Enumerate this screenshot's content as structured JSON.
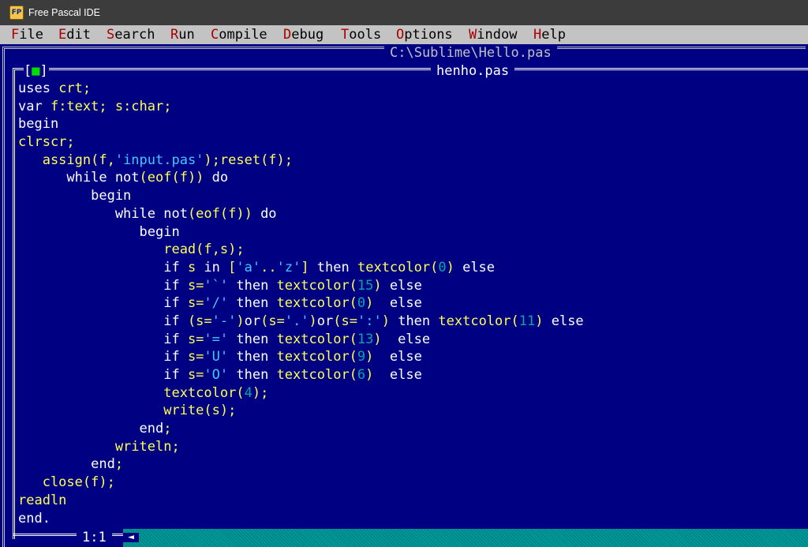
{
  "window": {
    "app_title": "Free Pascal IDE",
    "app_icon": "free-pascal-icon"
  },
  "menu": {
    "items": [
      {
        "hot": "F",
        "rest": "ile"
      },
      {
        "hot": "E",
        "rest": "dit"
      },
      {
        "hot": "S",
        "rest": "earch"
      },
      {
        "hot": "R",
        "rest": "un"
      },
      {
        "hot": "C",
        "rest": "ompile"
      },
      {
        "hot": "D",
        "rest": "ebug"
      },
      {
        "hot": "T",
        "rest": "ools"
      },
      {
        "hot": "O",
        "rest": "ptions"
      },
      {
        "hot": "W",
        "rest": "indow"
      },
      {
        "hot": "H",
        "rest": "elp"
      }
    ]
  },
  "outer_window": {
    "title": "C:\\Sublime\\Hello.pas"
  },
  "inner_window": {
    "title": "henho.pas",
    "close_box": {
      "left": "[",
      "square": "■",
      "right": "]"
    }
  },
  "editor": {
    "lines": [
      [
        [
          "w",
          "uses "
        ],
        [
          "y",
          "crt;"
        ]
      ],
      [
        [
          "w",
          "var "
        ],
        [
          "y",
          "f:text; s:char;"
        ]
      ],
      [
        [
          "w",
          "begin"
        ]
      ],
      [
        [
          "y",
          "clrscr;"
        ]
      ],
      [
        [
          "y",
          "   assign(f,"
        ],
        [
          "c",
          "'input.pas'"
        ],
        [
          "y",
          ");reset(f);"
        ]
      ],
      [
        [
          "w",
          "      while not"
        ],
        [
          "y",
          "(eof(f))"
        ],
        [
          "w",
          " do"
        ]
      ],
      [
        [
          "w",
          "         begin"
        ]
      ],
      [
        [
          "w",
          "            while not"
        ],
        [
          "y",
          "(eof(f))"
        ],
        [
          "w",
          " do"
        ]
      ],
      [
        [
          "w",
          "               begin"
        ]
      ],
      [
        [
          "y",
          "                  read(f,s);"
        ]
      ],
      [
        [
          "w",
          "                  if "
        ],
        [
          "y",
          "s "
        ],
        [
          "w",
          "in "
        ],
        [
          "y",
          "["
        ],
        [
          "c",
          "'a'"
        ],
        [
          "y",
          ".."
        ],
        [
          "c",
          "'z'"
        ],
        [
          "y",
          "] "
        ],
        [
          "w",
          "then "
        ],
        [
          "y",
          "textcolor("
        ],
        [
          "n",
          "0"
        ],
        [
          "y",
          ")"
        ],
        [
          "w",
          " else"
        ]
      ],
      [
        [
          "w",
          "                  if "
        ],
        [
          "y",
          "s="
        ],
        [
          "c",
          "'`'"
        ],
        [
          "w",
          " then "
        ],
        [
          "y",
          "textcolor("
        ],
        [
          "n",
          "15"
        ],
        [
          "y",
          ")"
        ],
        [
          "w",
          " else"
        ]
      ],
      [
        [
          "w",
          "                  if "
        ],
        [
          "y",
          "s="
        ],
        [
          "c",
          "'/'"
        ],
        [
          "w",
          " then "
        ],
        [
          "y",
          "textcolor("
        ],
        [
          "n",
          "0"
        ],
        [
          "y",
          ")"
        ],
        [
          "w",
          "  else"
        ]
      ],
      [
        [
          "w",
          "                  if "
        ],
        [
          "y",
          "(s="
        ],
        [
          "c",
          "'-'"
        ],
        [
          "y",
          ")"
        ],
        [
          "w",
          "or"
        ],
        [
          "y",
          "(s="
        ],
        [
          "c",
          "'.'"
        ],
        [
          "y",
          ")"
        ],
        [
          "w",
          "or"
        ],
        [
          "y",
          "(s="
        ],
        [
          "c",
          "':'"
        ],
        [
          "y",
          ")"
        ],
        [
          "w",
          " then "
        ],
        [
          "y",
          "textcolor("
        ],
        [
          "n",
          "11"
        ],
        [
          "y",
          ")"
        ],
        [
          "w",
          " else"
        ]
      ],
      [
        [
          "w",
          "                  if "
        ],
        [
          "y",
          "s="
        ],
        [
          "c",
          "'='"
        ],
        [
          "w",
          " then "
        ],
        [
          "y",
          "textcolor("
        ],
        [
          "n",
          "13"
        ],
        [
          "y",
          ")"
        ],
        [
          "w",
          "  else"
        ]
      ],
      [
        [
          "w",
          "                  if "
        ],
        [
          "y",
          "s="
        ],
        [
          "c",
          "'U'"
        ],
        [
          "w",
          " then "
        ],
        [
          "y",
          "textcolor("
        ],
        [
          "n",
          "9"
        ],
        [
          "y",
          ")"
        ],
        [
          "w",
          "  else"
        ]
      ],
      [
        [
          "w",
          "                  if "
        ],
        [
          "y",
          "s="
        ],
        [
          "c",
          "'O'"
        ],
        [
          "w",
          " then "
        ],
        [
          "y",
          "textcolor("
        ],
        [
          "n",
          "6"
        ],
        [
          "y",
          ")"
        ],
        [
          "w",
          "  else"
        ]
      ],
      [
        [
          "y",
          "                  textcolor("
        ],
        [
          "n",
          "4"
        ],
        [
          "y",
          ");"
        ]
      ],
      [
        [
          "y",
          "                  write(s);"
        ]
      ],
      [
        [
          "w",
          "               end"
        ],
        [
          "y",
          ";"
        ]
      ],
      [
        [
          "y",
          "            writeln;"
        ]
      ],
      [
        [
          "w",
          "         end"
        ],
        [
          "y",
          ";"
        ]
      ],
      [
        [
          "y",
          "   close(f);"
        ]
      ],
      [
        [
          "y",
          "readln"
        ]
      ],
      [
        [
          "w",
          "end."
        ]
      ]
    ]
  },
  "status": {
    "cursor_position": "1:1"
  },
  "scrollbar": {
    "thumb_icon": "scroll-thumb-icon",
    "thumb_glyph": "◄"
  },
  "colors": {
    "background": "#000082",
    "keyword": "#ffffff",
    "identifier": "#ffff55",
    "string": "#40c8ff",
    "number": "#00a8a8",
    "scrollbar": "#009898",
    "menubar": "#c3c3c3",
    "menu_hotkey": "#a80000"
  }
}
